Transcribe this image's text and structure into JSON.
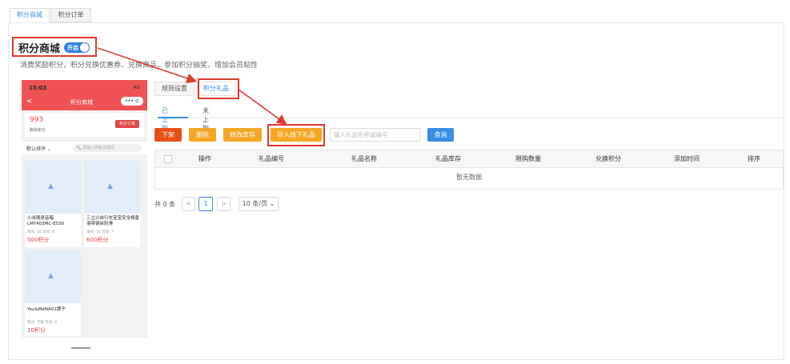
{
  "top_tabs": [
    "积分商城",
    "积分订单"
  ],
  "header": {
    "title": "积分商城",
    "toggle_label": "开启",
    "description": "消费奖励积分，积分兑换优惠券、兑换商品，参加积分抽奖，增加会员粘性"
  },
  "phone": {
    "time": "15:03",
    "status_icons": "4G",
    "back": "<",
    "nav_title": "积分商城",
    "capsule": "••• ⊙",
    "points_value": "993",
    "points_label": "剩余积分",
    "orders_button": "积分订单",
    "sort_label": "默认排序",
    "search_placeholder": "请输入搜索关键词",
    "products": [
      {
        "name": "小米随身音箱 LMY403MC-E530",
        "meta": "限兑: 10  可兑: 8",
        "price": "500积分"
      },
      {
        "name": "三立兴自行车宝宝安全椅香港带钢丝防滑",
        "meta": "限兑: 10  可兑: 7",
        "price": "600积分"
      },
      {
        "name": "You&MeNA01牌子",
        "meta": "限兑: 不限  可兑: 0",
        "price": "10积分"
      }
    ]
  },
  "sub_tabs": [
    "规则设置",
    "积分礼品"
  ],
  "inner_tabs": [
    "已上架",
    "未上架"
  ],
  "toolbar": {
    "offline_label": "下架",
    "delete_label": "删除",
    "stock_label": "修改库存",
    "import_label": "导入线下礼品",
    "search_placeholder": "输入礼品名称或编号",
    "query_label": "查询"
  },
  "colors": {
    "offline": "#e8501a",
    "orange": "#f5a623",
    "query": "#3a8ee6",
    "annotation": "#e03a2e"
  },
  "table": {
    "headers": [
      "操作",
      "礼品编号",
      "礼品名称",
      "礼品库存",
      "限购数量",
      "兑换积分",
      "添加时间",
      "排序"
    ],
    "empty_text": "暂无数据"
  },
  "pagination": {
    "total": "共 0 条",
    "prev": "<",
    "page": "1",
    "next": ">",
    "page_size": "10 条/页"
  }
}
